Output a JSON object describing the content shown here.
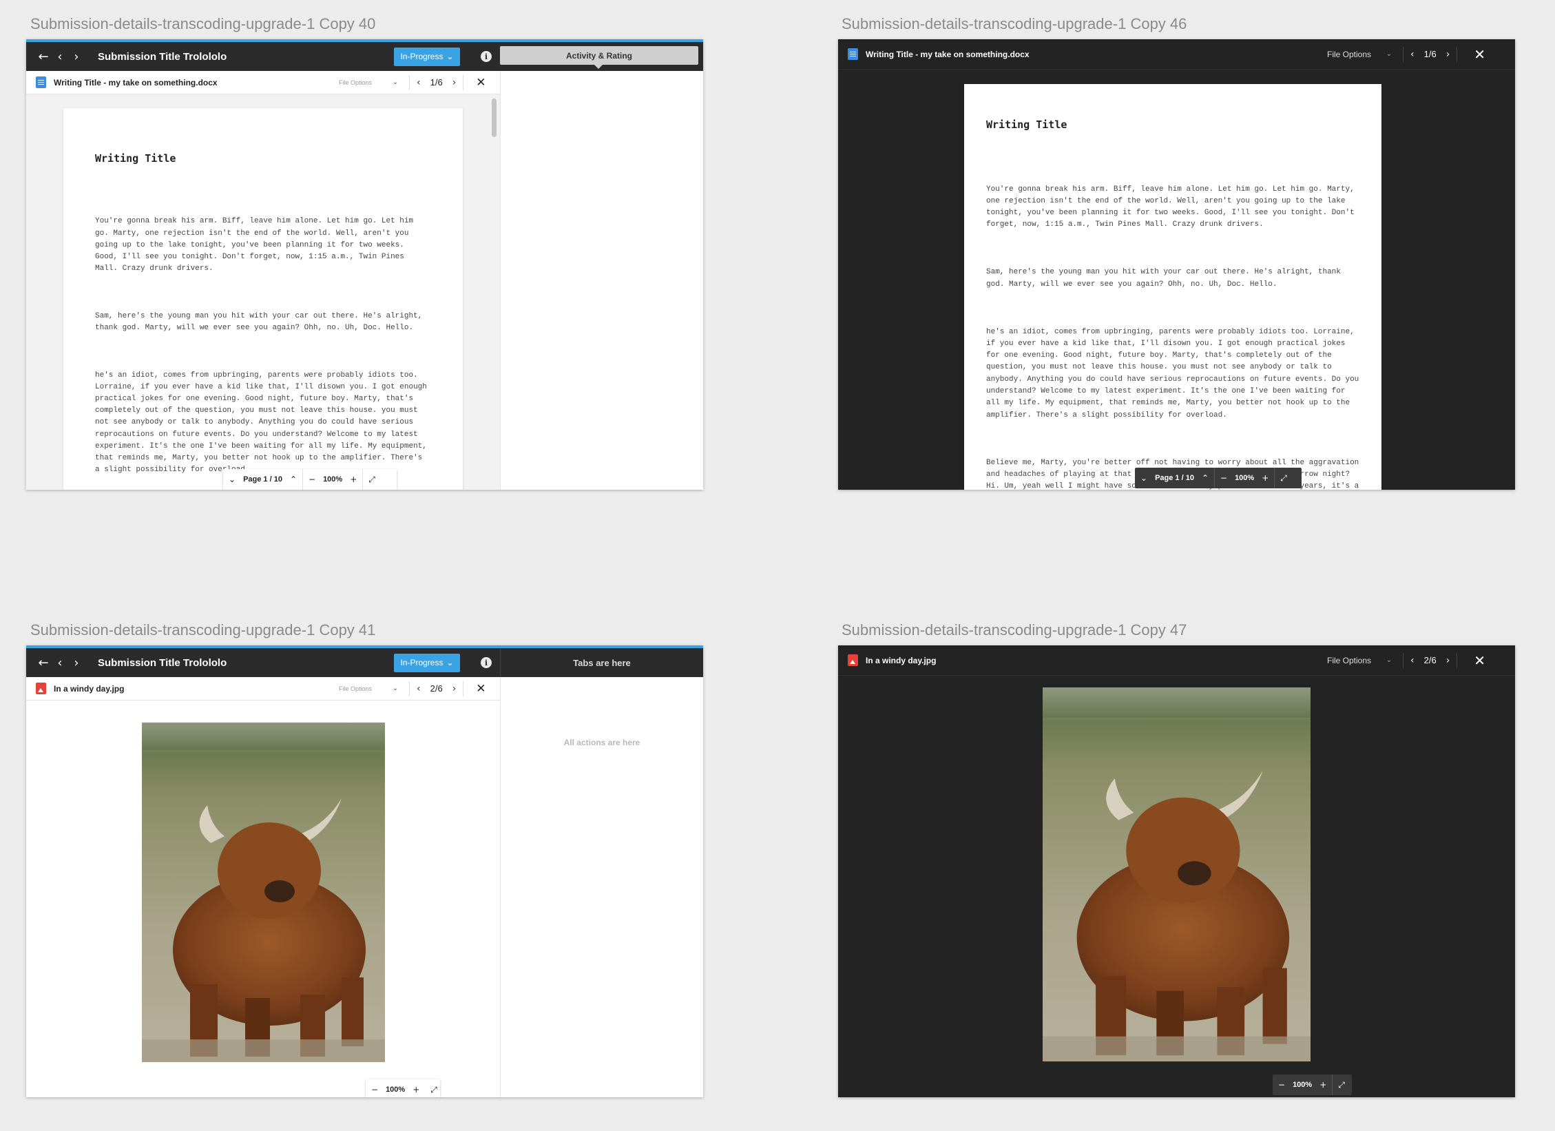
{
  "boards": {
    "b40": {
      "label": "Submission-details-transcoding-upgrade-1 Copy 40"
    },
    "b46": {
      "label": "Submission-details-transcoding-upgrade-1 Copy 46"
    },
    "b41": {
      "label": "Submission-details-transcoding-upgrade-1 Copy 41"
    },
    "b47": {
      "label": "Submission-details-transcoding-upgrade-1 Copy 47"
    }
  },
  "header": {
    "nav_back": "←",
    "nav_prev": "‹",
    "nav_next": "›",
    "submission_title": "Submission Title Trolololo",
    "status_label": "In-Progress",
    "status_caret": "⌄",
    "info": "i",
    "activity_tab": "Activity & Rating",
    "tabs_placeholder": "Tabs are here",
    "actions_placeholder": "All actions are here"
  },
  "doc_file": {
    "name": "Writing Title - my take on something.docx",
    "options": "File Options",
    "page_counter": "1/6"
  },
  "img_file": {
    "name": "In a windy day.jpg",
    "options": "File Options",
    "page_counter": "2/6"
  },
  "controls": {
    "down": "⌄",
    "up": "⌃",
    "page_label": "Page 1 / 10",
    "zoom_out": "−",
    "zoom_level": "100%",
    "zoom_in": "+",
    "expand": "⤢",
    "prev": "‹",
    "next": "›",
    "close": "✕",
    "dropdown": "⌄"
  },
  "document": {
    "title": "Writing Title",
    "paragraphs": [
      "You're gonna break his arm. Biff, leave him alone. Let him go. Let him go. Marty, one rejection isn't the end of the world. Well, aren't you going up to the lake tonight, you've been planning it for two weeks. Good, I'll see you tonight. Don't forget, now, 1:15 a.m., Twin Pines Mall. Crazy drunk drivers.",
      "Sam, here's the young man you hit with your car out there. He's alright, thank god. Marty, will we ever see you again? Ohh, no. Uh, Doc. Hello.",
      "he's an idiot, comes from upbringing, parents were probably idiots too. Lorraine, if you ever have a kid like that, I'll disown you. I got enough practical jokes for one evening. Good night, future boy. Marty, that's completely out of the question, you must not leave this house. you must not see anybody or talk to anybody. Anything you do could have serious reprocautions on future events. Do you understand? Welcome to my latest experiment. It's the one I've been waiting for all my life. My equipment, that reminds me, Marty, you better not hook up to the amplifier. There's a slight possibility for overload.",
      "Believe me, Marty, you're better off not having to worry about all the aggravation and headaches of playing at that dance. Does your mom know about tomorrow night? Hi. Um, yeah well I might have sort of ran into my parents. About 30 years, it's a nice round number."
    ]
  },
  "colors": {
    "accent": "#3aa3e6",
    "dark_bg": "#232323",
    "topbar": "#2b2b2b",
    "doc_icon": "#3a8de0",
    "img_icon": "#e5433a"
  }
}
